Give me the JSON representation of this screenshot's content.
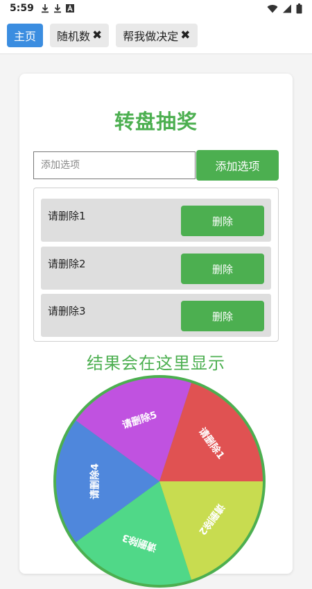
{
  "status_bar": {
    "time": "5:59",
    "left_icons": [
      "download-icon",
      "download-icon",
      "font-icon"
    ],
    "right_icons": [
      "wifi-icon",
      "signal-icon",
      "battery-icon"
    ]
  },
  "tabs": [
    {
      "label": "主页",
      "active": true,
      "closable": false
    },
    {
      "label": "随机数",
      "active": false,
      "closable": true
    },
    {
      "label": "帮我做决定",
      "active": false,
      "closable": true
    }
  ],
  "title": "转盘抽奖",
  "input": {
    "value": "",
    "placeholder": "添加选项"
  },
  "add_button_label": "添加选项",
  "items": [
    {
      "label": "请删除1",
      "delete_label": "删除"
    },
    {
      "label": "请删除2",
      "delete_label": "删除"
    },
    {
      "label": "请删除3",
      "delete_label": "删除"
    }
  ],
  "result_text": "结果会在这里显示",
  "wheel": {
    "border_color": "#4caf50",
    "segments": [
      {
        "label": "请删除1",
        "color": "#e05252"
      },
      {
        "label": "请删除2",
        "color": "#c8dc50"
      },
      {
        "label": "请删除3",
        "color": "#50d888"
      },
      {
        "label": "请删除4",
        "color": "#4f87dc"
      },
      {
        "label": "请删除5",
        "color": "#c052e0"
      }
    ]
  },
  "colors": {
    "accent": "#4caf50",
    "tab_active": "#3b8de0"
  }
}
